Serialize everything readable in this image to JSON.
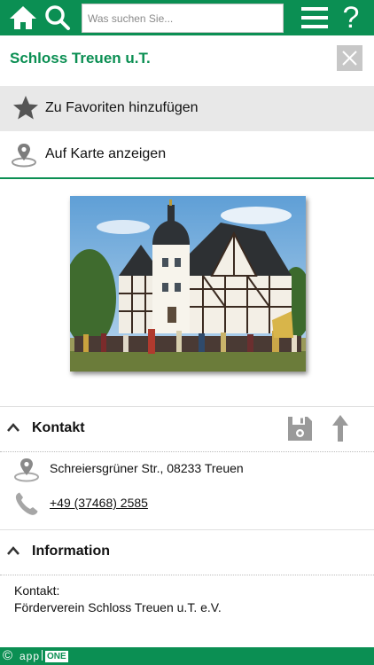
{
  "topbar": {
    "search_placeholder": "Was suchen Sie...",
    "help_label": "?",
    "icons": [
      "home-icon",
      "search-icon",
      "menu-icon",
      "help-icon"
    ]
  },
  "header": {
    "title": "Schloss Treuen u.T."
  },
  "actions": {
    "favorites_label": "Zu Favoriten hinzufügen",
    "map_label": "Auf Karte anzeigen"
  },
  "photo": {
    "subject": "Schloss Treuen castle with crowd in front"
  },
  "kontakt": {
    "title": "Kontakt",
    "address": "Schreiersgrüner Str., 08233 Treuen",
    "phone": "+49 (37468) 2585"
  },
  "information": {
    "title": "Information",
    "line1": "Kontakt:",
    "line2": "Förderverein Schloss Treuen u.T. e.V."
  },
  "footer": {
    "copyright": "©",
    "brand_left": "app",
    "brand_right": "ONE"
  },
  "colors": {
    "brand_green": "#0b8f53",
    "row_gray": "#e8e8e8",
    "icon_gray": "#9a9a9a",
    "link_blue": "#1a0dab"
  }
}
